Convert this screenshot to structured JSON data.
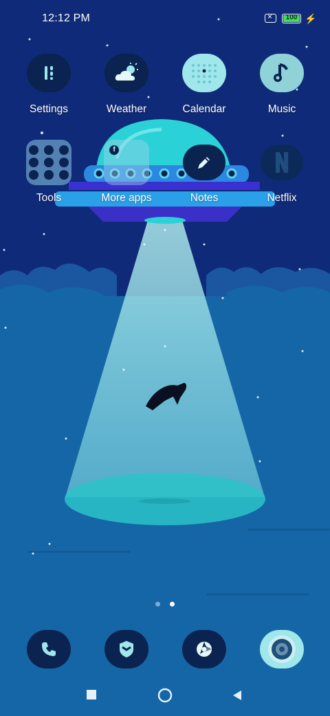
{
  "status_bar": {
    "time": "12:12 PM",
    "battery_percent": "100"
  },
  "home_row_1": [
    {
      "label": "Settings",
      "icon": "settings-sliders-icon"
    },
    {
      "label": "Weather",
      "icon": "weather-cloud-sun-icon"
    },
    {
      "label": "Calendar",
      "icon": "calendar-dots-icon"
    },
    {
      "label": "Music",
      "icon": "music-note-icon"
    }
  ],
  "home_row_2": [
    {
      "label": "Tools",
      "icon": "tools-folder-icon"
    },
    {
      "label": "More apps",
      "icon": "more-apps-folder-icon"
    },
    {
      "label": "Notes",
      "icon": "notes-pen-icon"
    },
    {
      "label": "Netflix",
      "icon": "netflix-icon"
    }
  ],
  "page_indicator": {
    "pages": 2,
    "active": 2
  },
  "dock": [
    {
      "name": "phone",
      "icon": "phone-icon"
    },
    {
      "name": "security",
      "icon": "shield-icon"
    },
    {
      "name": "browser",
      "icon": "browser-aperture-icon"
    },
    {
      "name": "camera",
      "icon": "camera-icon"
    }
  ],
  "colors": {
    "sky": "#0f2a78",
    "hills": "#1a5da4",
    "ground": "#1566a6",
    "beam": "#8fd8e6",
    "ufo_dome": "#2ad1d6",
    "icon_bg": "#0b2350",
    "battery_fill": "#3de05a"
  }
}
